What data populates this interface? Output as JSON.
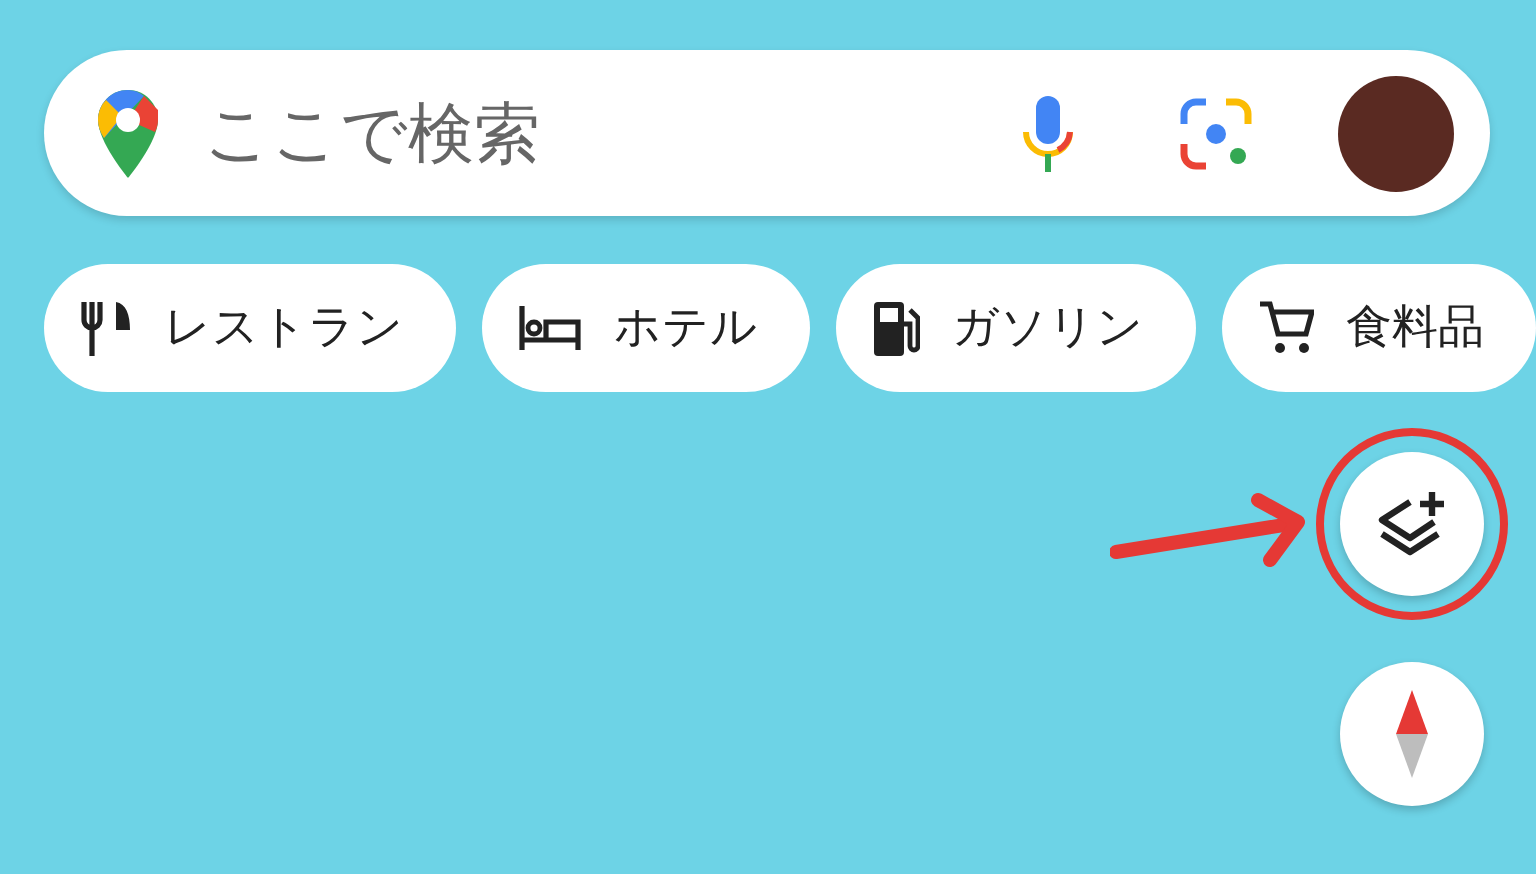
{
  "search": {
    "placeholder": "ここで検索"
  },
  "categories": [
    {
      "kind": "restaurant",
      "label": "レストラン"
    },
    {
      "kind": "hotel",
      "label": "ホテル"
    },
    {
      "kind": "gas",
      "label": "ガソリン"
    },
    {
      "kind": "grocery",
      "label": "食料品"
    }
  ]
}
